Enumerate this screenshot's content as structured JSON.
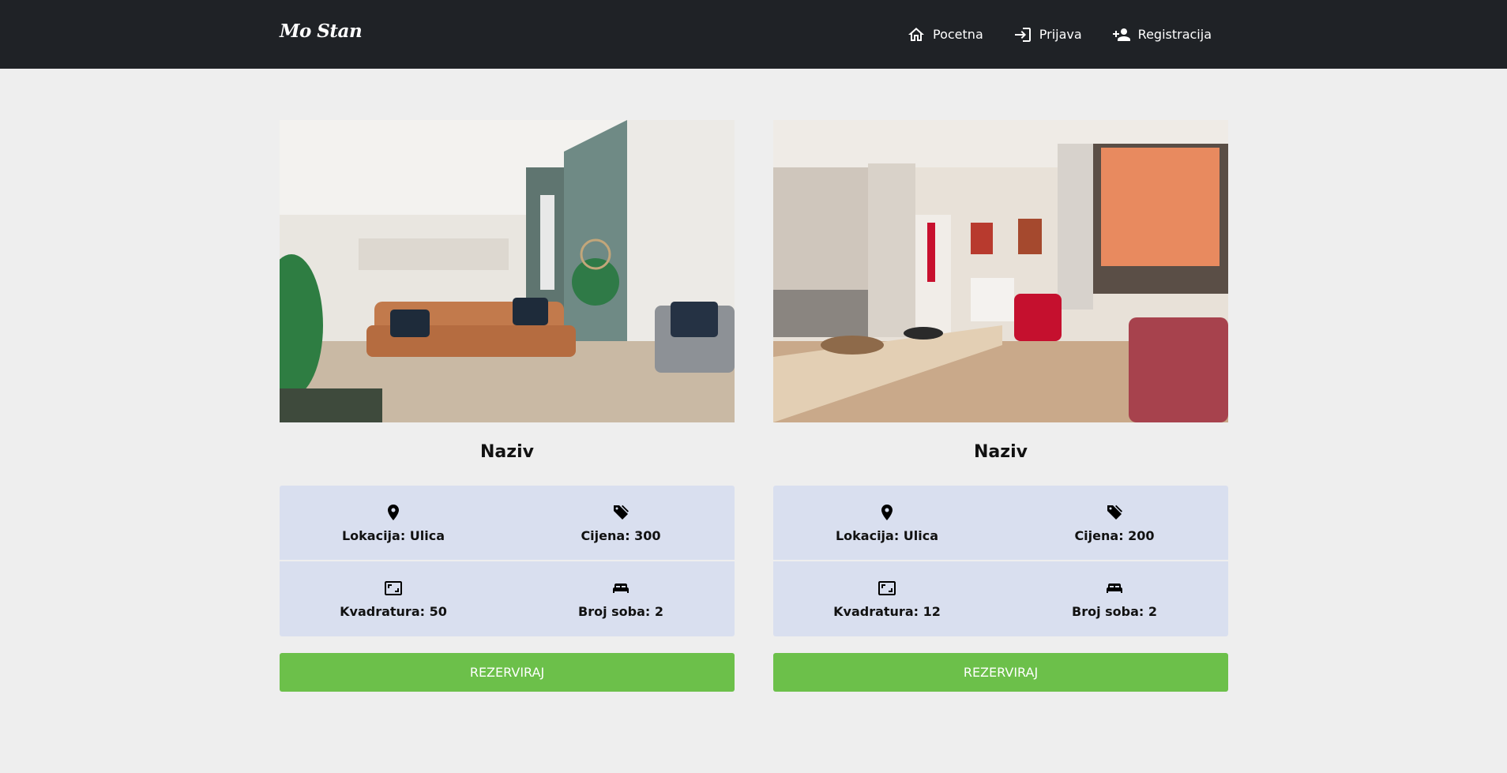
{
  "header": {
    "brand": "Mo Stan",
    "nav": [
      {
        "label": "Pocetna",
        "icon": "home-icon"
      },
      {
        "label": "Prijava",
        "icon": "login-icon"
      },
      {
        "label": "Registracija",
        "icon": "person-add-icon"
      }
    ]
  },
  "listings": [
    {
      "title": "Naziv",
      "location": "Lokacija: Ulica",
      "price": "Cijena: 300",
      "area": "Kvadratura: 50",
      "rooms": "Broj soba: 2",
      "button": "REZERVIRAJ",
      "image": "living room with orange sofa"
    },
    {
      "title": "Naziv",
      "location": "Lokacija: Ulica",
      "price": "Cijena: 200",
      "area": "Kvadratura: 12",
      "rooms": "Broj soba: 2",
      "button": "REZERVIRAJ",
      "image": "kitchen dining room with red armchair"
    }
  ],
  "colors": {
    "navbar": "#1f2226",
    "background": "#eeeeee",
    "info_panel": "#d9dfef",
    "button": "#6cc04a"
  }
}
